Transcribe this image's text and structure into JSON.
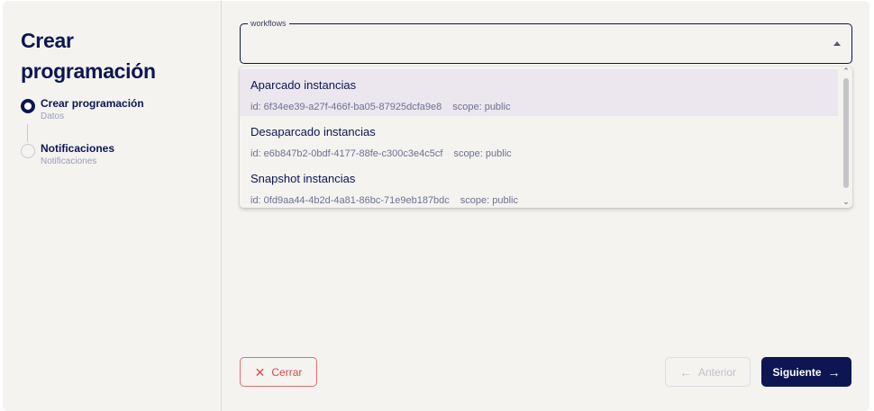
{
  "sidebar": {
    "title": "Crear programación",
    "steps": [
      {
        "label": "Crear programación",
        "sub": "Datos",
        "state": "active"
      },
      {
        "label": "Notificaciones",
        "sub": "Notificaciones",
        "state": "inactive"
      }
    ]
  },
  "select": {
    "label": "workflows",
    "value": "",
    "options": [
      {
        "title": "Aparcado instancias",
        "id": "id: 6f34ee39-a27f-466f-ba05-87925dcfa9e8",
        "scope": "scope: public"
      },
      {
        "title": "Desaparcado instancias",
        "id": "id: e6b847b2-0bdf-4177-88fe-c300c3e4c5cf",
        "scope": "scope: public"
      },
      {
        "title": "Snapshot instancias",
        "id": "id: 0fd9aa44-4b2d-4a81-86bc-71e9eb187bdc",
        "scope": "scope: public"
      }
    ]
  },
  "footer": {
    "close_label": "Cerrar",
    "prev_label": "Anterior",
    "next_label": "Siguiente"
  },
  "colors": {
    "primary": "#0d1552",
    "danger": "#d74b4b",
    "background": "#f4f3f0",
    "highlight": "#ece6ee"
  }
}
